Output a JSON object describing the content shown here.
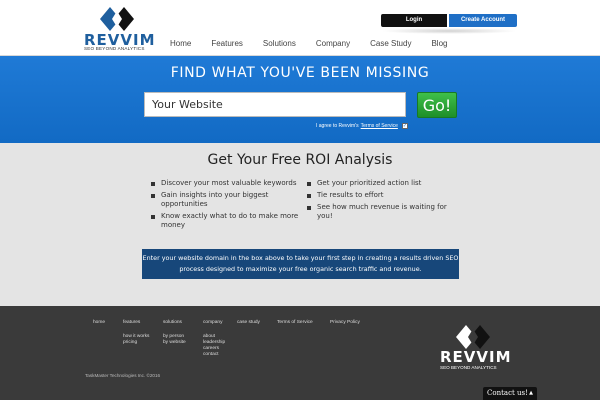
{
  "header": {
    "logo_word": "REVVIM",
    "logo_tagline": "SEO BEYOND ANALYTICS",
    "nav": [
      "Home",
      "Features",
      "Solutions",
      "Company",
      "Case Study",
      "Blog"
    ],
    "login_label": "Login",
    "create_account_label": "Create Account"
  },
  "hero": {
    "title": "FIND WHAT YOU'VE BEEN MISSING",
    "input_value": "Your Website",
    "go_label": "Go!",
    "agree_text": "I agree to Revvim's",
    "tos_link": "Terms of Service",
    "agree_checked": true
  },
  "main": {
    "title": "Get Your Free ROI Analysis",
    "left_bullets": [
      "Discover your most valuable keywords",
      "Gain insights into your biggest opportunities",
      "Know exactly what to do to make more money"
    ],
    "right_bullets": [
      "Get your prioritized action list",
      "Tie results to effort",
      "See how much revenue is waiting for you!"
    ],
    "cta_text": "Enter your website domain in the box above to take your first step in creating a results driven SEO process designed to maximize your free organic search traffic and revenue."
  },
  "footer": {
    "columns": [
      {
        "head": "home",
        "items": []
      },
      {
        "head": "features",
        "items": [
          "how it works",
          "pricing"
        ]
      },
      {
        "head": "solutions",
        "items": [
          "by person",
          "by website"
        ]
      },
      {
        "head": "company",
        "items": [
          "about",
          "leadership",
          "careers",
          "contact"
        ]
      },
      {
        "head": "case study",
        "items": []
      },
      {
        "head": "Terms of Service",
        "items": []
      },
      {
        "head": "Privacy Policy",
        "items": []
      }
    ],
    "copyright": "TaskMaster Technologies Inc. ©2016",
    "logo_word": "REVVIM",
    "logo_tagline": "SEO BEYOND ANALYTICS"
  },
  "chat": {
    "label": "Contact us!"
  },
  "colors": {
    "brand_blue": "#1f7ad6",
    "go_green": "#2eaa38",
    "cta_navy": "#17477a",
    "footer_bg": "#3a3a3a"
  }
}
